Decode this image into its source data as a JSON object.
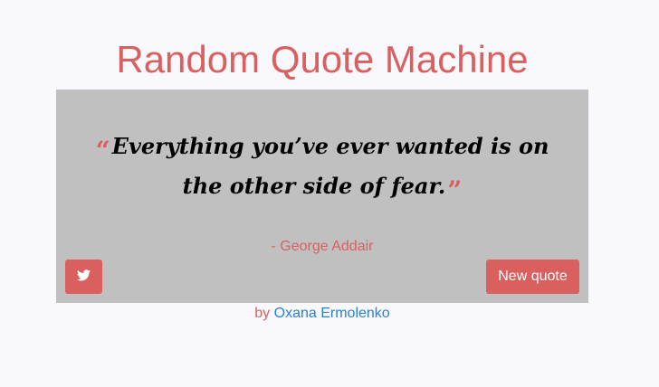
{
  "header": {
    "title": "Random Quote Machine"
  },
  "quote": {
    "open_mark": "“",
    "text": "Everything you’ve ever wanted is on the other side of fear.",
    "close_mark": "”",
    "author": "- George Addair"
  },
  "actions": {
    "tweet_icon": "twitter-icon",
    "new_quote_label": "New quote"
  },
  "footer": {
    "by_label": "by",
    "author_link": "Oxana Ermolenko"
  },
  "colors": {
    "accent": "#d9605f",
    "card_bg": "#c0c0c0",
    "page_bg": "#f8f8fd",
    "link": "#2a7fd6"
  }
}
